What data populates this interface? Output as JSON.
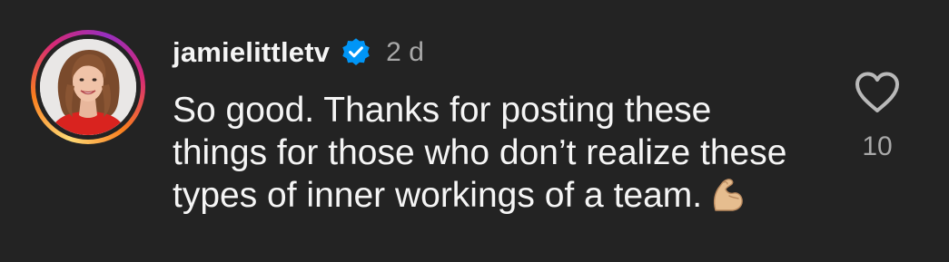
{
  "comment": {
    "username": "jamielittletv",
    "verified": true,
    "timestamp": "2 d",
    "text": "So good. Thanks for posting these things for those who don’t realize these types of inner workings of a team.",
    "emoji": "flexed-biceps",
    "like_count": "10"
  },
  "icons": {
    "verified": "verified-badge-icon",
    "like": "heart-outline-icon"
  },
  "colors": {
    "background": "#232323",
    "text": "#f5f5f5",
    "muted": "#a8a8a8",
    "verified_blue": "#0095f6"
  }
}
